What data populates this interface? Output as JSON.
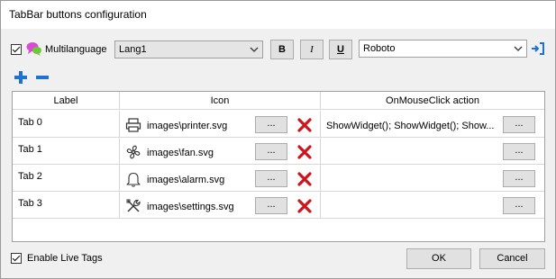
{
  "window": {
    "title": "TabBar buttons configuration"
  },
  "toolbar": {
    "multilanguage_label": "Multilanguage",
    "multilanguage_checked": true,
    "language_value": "Lang1",
    "bold_label": "B",
    "italic_label": "I",
    "underline_label": "U",
    "font_value": "Roboto"
  },
  "list_actions": {
    "add_icon": "plus-icon",
    "remove_icon": "minus-icon"
  },
  "table": {
    "columns": [
      "Label",
      "Icon",
      "OnMouseClick action"
    ],
    "browse_label": "...",
    "rows": [
      {
        "label": "Tab 0",
        "icon_name": "printer-icon",
        "icon_path": "images\\printer.svg",
        "action": "ShowWidget(); ShowWidget(); Show..."
      },
      {
        "label": "Tab 1",
        "icon_name": "fan-icon",
        "icon_path": "images\\fan.svg",
        "action": ""
      },
      {
        "label": "Tab 2",
        "icon_name": "alarm-icon",
        "icon_path": "images\\alarm.svg",
        "action": ""
      },
      {
        "label": "Tab 3",
        "icon_name": "settings-icon",
        "icon_path": "images\\settings.svg",
        "action": ""
      }
    ]
  },
  "footer": {
    "live_tags_label": "Enable Live Tags",
    "live_tags_checked": true,
    "ok_label": "OK",
    "cancel_label": "Cancel"
  },
  "colors": {
    "accent": "#1e73d2",
    "delete": "#d0141c",
    "grid_line": "#d8d8d8"
  }
}
